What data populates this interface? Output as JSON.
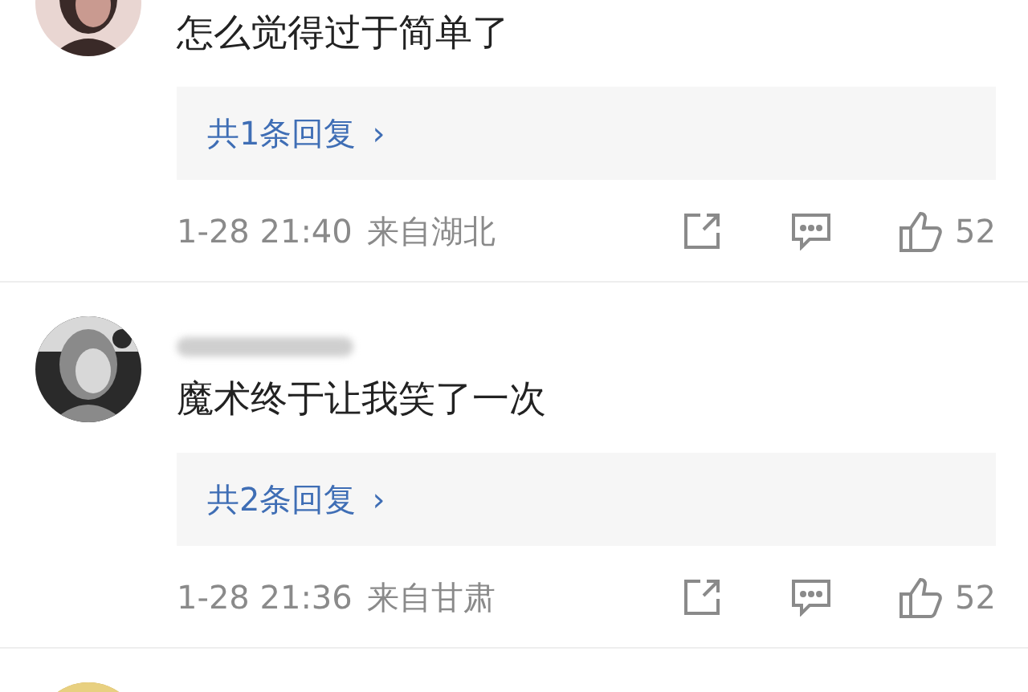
{
  "comments": [
    {
      "avatar": {
        "kind": "picture"
      },
      "text": "怎么觉得过于简单了",
      "replies": "共1条回复",
      "reply_arrow": "›",
      "time": "1-28 21:40",
      "location": "来自湖北",
      "likes": "52"
    },
    {
      "avatar": {
        "kind": "picture"
      },
      "name_obscured": true,
      "text": "魔术终于让我笑了一次",
      "replies": "共2条回复",
      "reply_arrow": "›",
      "time": "1-28 21:36",
      "location": "来自甘肃",
      "likes": "52"
    },
    {
      "avatar": {
        "kind": "picture"
      }
    }
  ]
}
